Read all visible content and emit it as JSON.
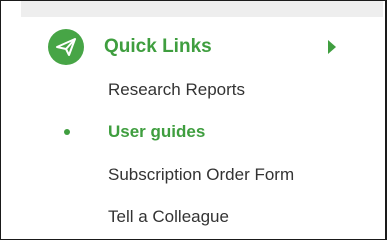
{
  "panel": {
    "title": "Quick Links",
    "icon": "paper-plane-icon",
    "expand_icon": "chevron-right-icon",
    "accent_color": "#3f9e3f",
    "items": [
      {
        "label": "Research Reports",
        "active": false
      },
      {
        "label": "User guides",
        "active": true
      },
      {
        "label": "Subscription Order Form",
        "active": false
      },
      {
        "label": "Tell a Colleague",
        "active": false
      }
    ]
  }
}
